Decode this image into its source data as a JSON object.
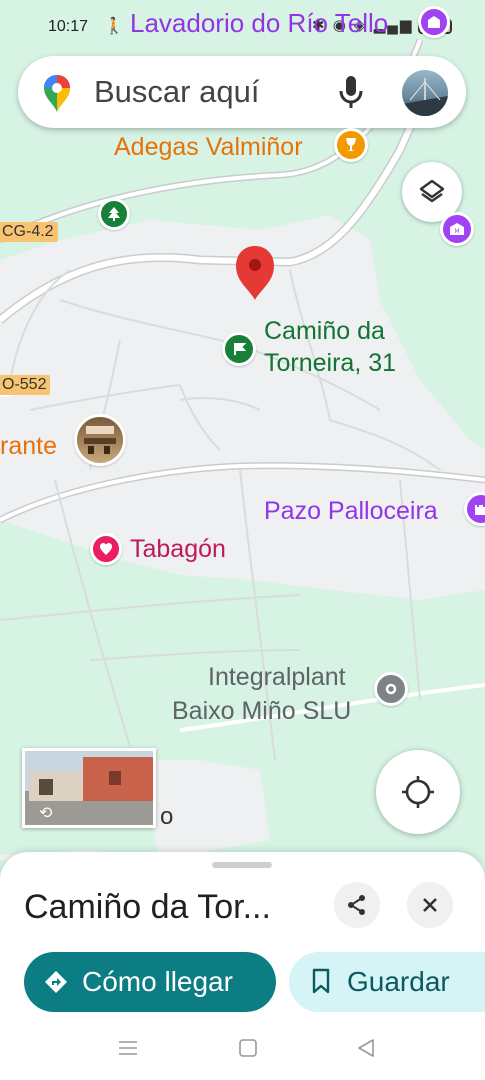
{
  "status_bar": {
    "time": "10:17",
    "battery": "97"
  },
  "search": {
    "placeholder": "Buscar aquí"
  },
  "map": {
    "labels": {
      "lavadorio": "Lavadorio do Río Tello",
      "adegas": "Adegas Valmiñor",
      "camino_line1": "Camiño da",
      "camino_line2": "Torneira, 31",
      "restaurante": "rante",
      "pazo": "Pazo Palloceira",
      "tabagon": "Tabagón",
      "integral_line1": "Integralplant",
      "integral_line2": "Baixo Miño SLU",
      "partial_o": "o"
    },
    "road_badges": {
      "cg": "CG-4.2",
      "po": "O-552"
    },
    "colors": {
      "land": "#d6f3e3",
      "urban": "#eef0f1",
      "pin": "#e53935",
      "green_poi": "#188038",
      "purple_poi": "#a142f4",
      "orange_poi": "#e8710a",
      "pink_poi": "#e91e63"
    }
  },
  "sheet": {
    "title": "Camiño da Tor...",
    "directions_label": "Cómo llegar",
    "save_label": "Guardar"
  }
}
